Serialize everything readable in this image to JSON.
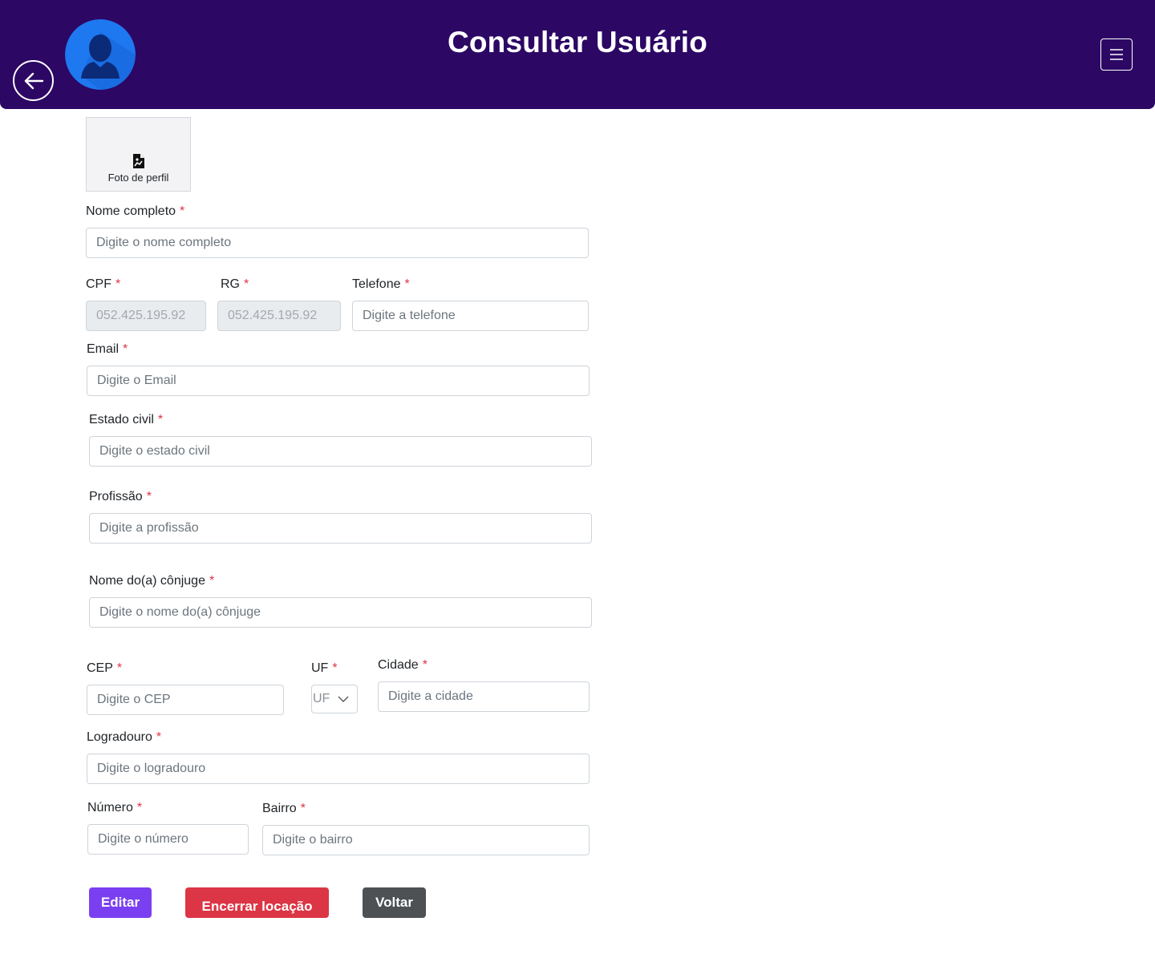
{
  "header": {
    "title": "Consultar Usuário"
  },
  "photo": {
    "label": "Foto de perfil"
  },
  "form": {
    "nome_completo": {
      "label": "Nome completo",
      "placeholder": "Digite o nome completo"
    },
    "cpf": {
      "label": "CPF",
      "value": "052.425.195.92"
    },
    "rg": {
      "label": "RG",
      "value": "052.425.195.92"
    },
    "telefone": {
      "label": "Telefone",
      "placeholder": "Digite a telefone"
    },
    "email": {
      "label": "Email",
      "placeholder": "Digite o Email"
    },
    "estado_civil": {
      "label": "Estado civil",
      "placeholder": "Digite o estado civil"
    },
    "profissao": {
      "label": "Profissão",
      "placeholder": "Digite a profissão"
    },
    "conjuge": {
      "label": "Nome do(a) cônjuge",
      "placeholder": "Digite o nome do(a) cônjuge"
    },
    "cep": {
      "label": "CEP",
      "placeholder": "Digite o CEP"
    },
    "uf": {
      "label": "UF",
      "selected": "UF"
    },
    "cidade": {
      "label": "Cidade",
      "placeholder": "Digite a cidade"
    },
    "logradouro": {
      "label": "Logradouro",
      "placeholder": "Digite o logradouro"
    },
    "numero": {
      "label": "Número",
      "placeholder": "Digite o número"
    },
    "bairro": {
      "label": "Bairro",
      "placeholder": "Digite o bairro"
    },
    "required_mark": "*"
  },
  "actions": {
    "edit_label": "Editar",
    "end_label": "Encerrar locação",
    "back_label": "Voltar"
  },
  "colors": {
    "header_bg": "#2c0764",
    "edit_btn": "#7b3ff2",
    "end_btn": "#dc3545",
    "back_btn": "#4d5154",
    "required": "#dc3545",
    "avatar": "#1e78f0"
  }
}
